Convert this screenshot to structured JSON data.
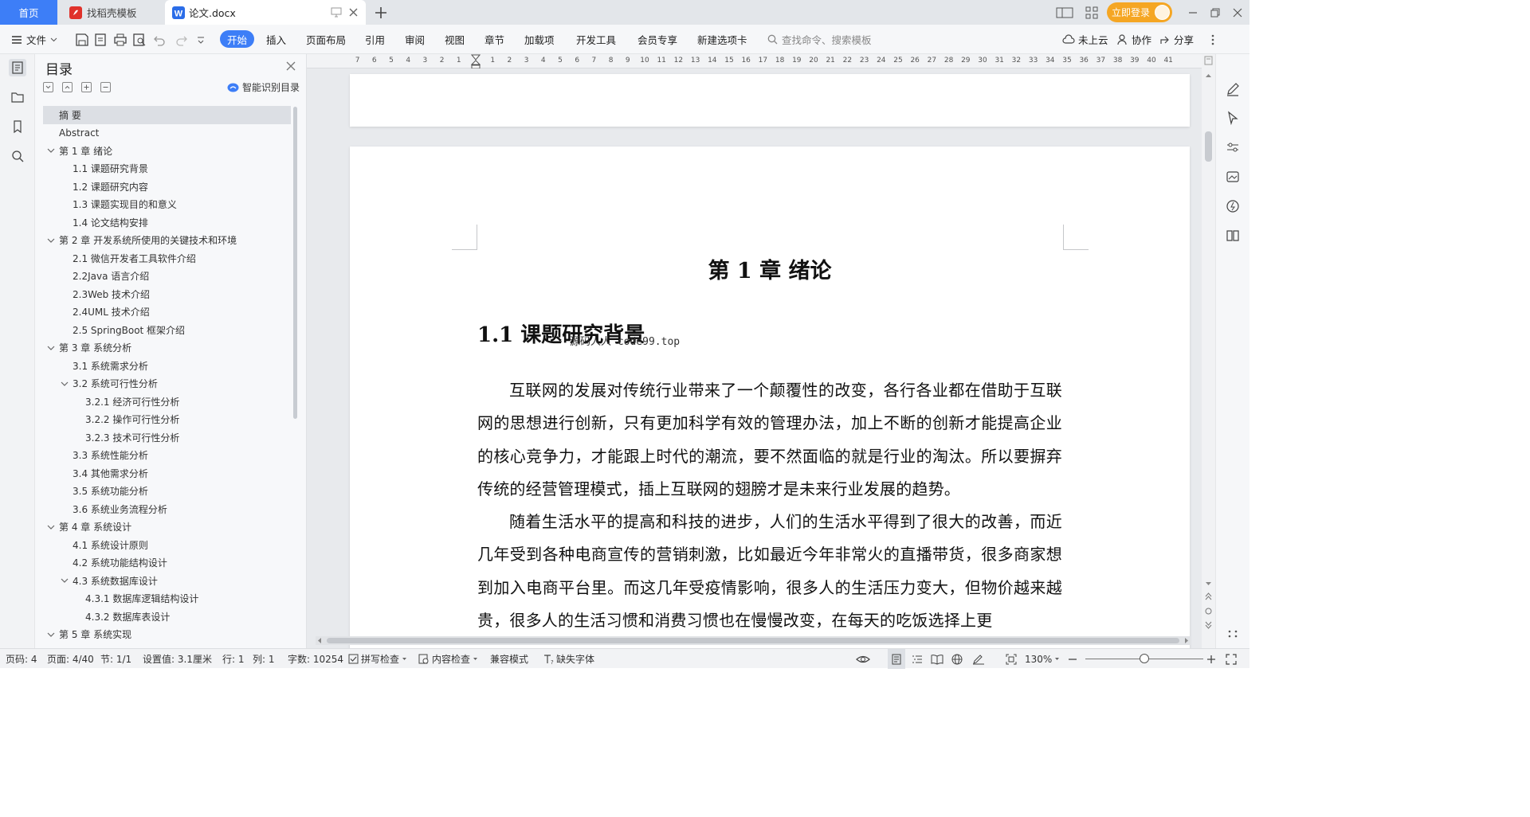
{
  "tabs": {
    "home": "首页",
    "template": "找稻壳模板",
    "document": "论文.docx",
    "login": "立即登录"
  },
  "menu": {
    "file": "文件",
    "items": [
      "开始",
      "插入",
      "页面布局",
      "引用",
      "审阅",
      "视图",
      "章节",
      "加载项",
      "开发工具",
      "会员专享",
      "新建选项卡"
    ],
    "search_placeholder": "查找命令、搜索模板",
    "cloud": "未上云",
    "collab": "协作",
    "share": "分享"
  },
  "toc": {
    "title": "目录",
    "smart": "智能识别目录",
    "items": [
      {
        "text": "摘  要",
        "level": 0,
        "selected": true
      },
      {
        "text": "Abstract",
        "level": 0
      },
      {
        "text": "第 1 章  绪论",
        "level": 0,
        "expand": true
      },
      {
        "text": "1.1 课题研究背景",
        "level": 1
      },
      {
        "text": "1.2 课题研究内容",
        "level": 1
      },
      {
        "text": "1.3 课题实现目的和意义",
        "level": 1
      },
      {
        "text": "1.4 论文结构安排",
        "level": 1
      },
      {
        "text": "第 2 章  开发系统所使用的关键技术和环境",
        "level": 0,
        "expand": true
      },
      {
        "text": "2.1 微信开发者工具软件介绍",
        "level": 1
      },
      {
        "text": "2.2Java 语言介绍",
        "level": 1
      },
      {
        "text": "2.3Web 技术介绍",
        "level": 1
      },
      {
        "text": "2.4UML 技术介绍",
        "level": 1
      },
      {
        "text": "2.5 SpringBoot 框架介绍",
        "level": 1
      },
      {
        "text": "第 3 章  系统分析",
        "level": 0,
        "expand": true
      },
      {
        "text": "3.1 系统需求分析",
        "level": 1
      },
      {
        "text": "3.2 系统可行性分析",
        "level": 1,
        "expand": true
      },
      {
        "text": "3.2.1 经济可行性分析",
        "level": 2
      },
      {
        "text": "3.2.2 操作可行性分析",
        "level": 2
      },
      {
        "text": "3.2.3 技术可行性分析",
        "level": 2
      },
      {
        "text": "3.3 系统性能分析",
        "level": 1
      },
      {
        "text": "3.4 其他需求分析",
        "level": 1
      },
      {
        "text": "3.5 系统功能分析",
        "level": 1
      },
      {
        "text": "3.6 系统业务流程分析",
        "level": 1
      },
      {
        "text": "第 4 章  系统设计",
        "level": 0,
        "expand": true
      },
      {
        "text": "4.1 系统设计原则",
        "level": 1
      },
      {
        "text": "4.2 系统功能结构设计",
        "level": 1
      },
      {
        "text": "4.3 系统数据库设计",
        "level": 1,
        "expand": true
      },
      {
        "text": "4.3.1 数据库逻辑结构设计",
        "level": 2
      },
      {
        "text": "4.3.2 数据库表设计",
        "level": 2
      },
      {
        "text": "第 5 章  系统实现",
        "level": 0,
        "expand": true
      }
    ]
  },
  "ruler": {
    "left": [
      "7",
      "6",
      "5",
      "4",
      "3",
      "2",
      "1"
    ],
    "right": [
      "1",
      "2",
      "3",
      "4",
      "5",
      "6",
      "7",
      "8",
      "9",
      "10",
      "11",
      "12",
      "13",
      "14",
      "15",
      "16",
      "17",
      "18",
      "19",
      "20",
      "21",
      "22",
      "23",
      "24",
      "25",
      "26",
      "27",
      "28",
      "29",
      "30",
      "31",
      "32",
      "33",
      "34",
      "35",
      "36",
      "37",
      "38",
      "39",
      "40",
      "41"
    ]
  },
  "document": {
    "chapter_title": "第 1 章  绪论",
    "section_title": "1.1 课题研究背景",
    "watermark": "源码人人 code99.top",
    "paragraphs": [
      "互联网的发展对传统行业带来了一个颠覆性的改变，各行各业都在借助于互联网的思想进行创新，只有更加科学有效的管理办法，加上不断的创新才能提高企业的核心竞争力，才能跟上时代的潮流，要不然面临的就是行业的淘汰。所以要摒弃传统的经营管理模式，插上互联网的翅膀才是未来行业发展的趋势。",
      "随着生活水平的提高和科技的进步，人们的生活水平得到了很大的改善，而近几年受到各种电商宣传的营销刺激，比如最近今年非常火的直播带货，很多商家想到加入电商平台里。而这几年受疫情影响，很多人的生活压力变大，但物价越来越贵，很多人的生活习惯和消费习惯也在慢慢改变，在每天的吃饭选择上更"
    ]
  },
  "status": {
    "page_num": "页码: 4",
    "pages": "页面: 4/40",
    "section": "节: 1/1",
    "setting": "设置值: 3.1厘米",
    "row": "行: 1",
    "col": "列: 1",
    "words": "字数: 10254",
    "spell": "拼写检查",
    "content_check": "内容检查",
    "compat": "兼容模式",
    "missing_font": "缺失字体",
    "zoom": "130%"
  },
  "colors": {
    "accent": "#3d7ef7",
    "login": "#f5a623"
  }
}
